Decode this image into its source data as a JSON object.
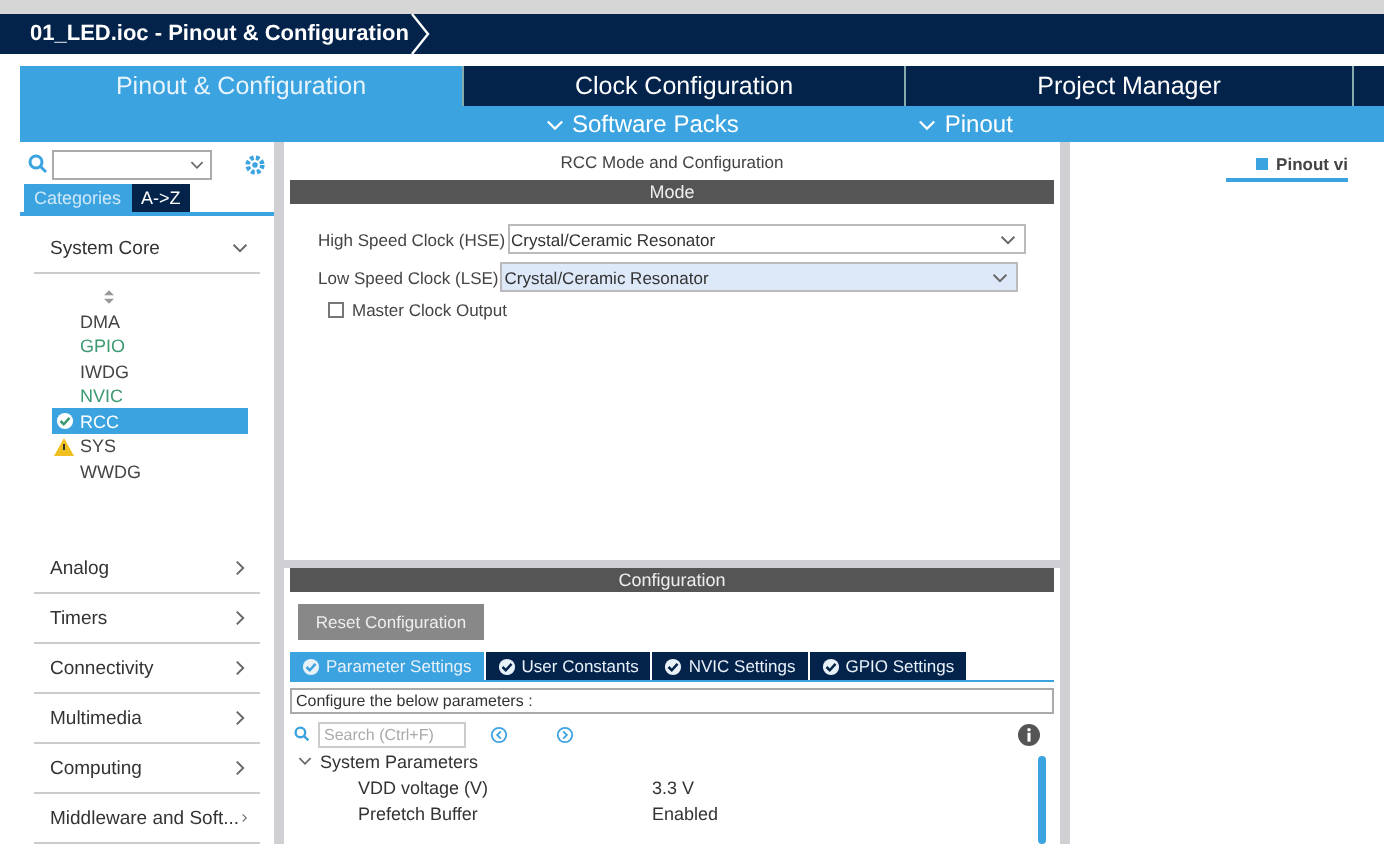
{
  "breadcrumb": "01_LED.ioc - Pinout & Configuration",
  "main_tabs": [
    {
      "label": "Pinout & Configuration",
      "selected": true
    },
    {
      "label": "Clock Configuration",
      "selected": false
    },
    {
      "label": "Project Manager",
      "selected": false
    },
    {
      "selected": false
    }
  ],
  "sub_menu": [
    "Software Packs",
    "Pinout"
  ],
  "sidebar": {
    "view_tabs": [
      {
        "label": "Categories",
        "selected": true
      },
      {
        "label": "A->Z",
        "selected": false
      }
    ],
    "categories": [
      {
        "label": "System Core",
        "expanded": true,
        "children": [
          {
            "label": "DMA",
            "kind": "plain",
            "configured": false,
            "selected": false
          },
          {
            "label": "GPIO",
            "kind": "plain",
            "configured": true,
            "selected": false
          },
          {
            "label": "IWDG",
            "kind": "plain",
            "configured": false,
            "selected": false
          },
          {
            "label": "NVIC",
            "kind": "plain",
            "configured": true,
            "selected": false
          },
          {
            "label": "RCC",
            "kind": "check",
            "configured": false,
            "selected": true
          },
          {
            "label": "SYS",
            "kind": "warning",
            "configured": false,
            "selected": false
          },
          {
            "label": "WWDG",
            "kind": "plain",
            "configured": false,
            "selected": false
          }
        ]
      },
      {
        "label": "Analog",
        "expanded": false
      },
      {
        "label": "Timers",
        "expanded": false
      },
      {
        "label": "Connectivity",
        "expanded": false
      },
      {
        "label": "Multimedia",
        "expanded": false
      },
      {
        "label": "Computing",
        "expanded": false
      },
      {
        "label": "Middleware and Soft...",
        "expanded": false
      }
    ]
  },
  "mode_panel": {
    "title": "RCC Mode and Configuration",
    "header": "Mode",
    "fields": [
      {
        "label": "High Speed Clock (HSE)",
        "value": "Crystal/Ceramic Resonator",
        "focused": false
      },
      {
        "label": "Low Speed Clock (LSE)",
        "value": "Crystal/Ceramic Resonator",
        "focused": true
      }
    ],
    "checkbox": {
      "label": "Master Clock Output",
      "checked": false
    }
  },
  "config_panel": {
    "header": "Configuration",
    "reset_button": "Reset Configuration",
    "tabs": [
      {
        "label": "Parameter Settings",
        "selected": true
      },
      {
        "label": "User Constants",
        "selected": false
      },
      {
        "label": "NVIC Settings",
        "selected": false
      },
      {
        "label": "GPIO Settings",
        "selected": false
      }
    ],
    "description": "Configure the below parameters :",
    "search": {
      "placeholder": "Search (Ctrl+F)"
    },
    "group": {
      "label": "System Parameters",
      "expanded": true,
      "rows": [
        {
          "name": "VDD voltage (V)",
          "value": "3.3 V"
        },
        {
          "name": "Prefetch Buffer",
          "value": "Enabled"
        }
      ]
    }
  },
  "right_panel": {
    "tab": "Pinout vi"
  }
}
